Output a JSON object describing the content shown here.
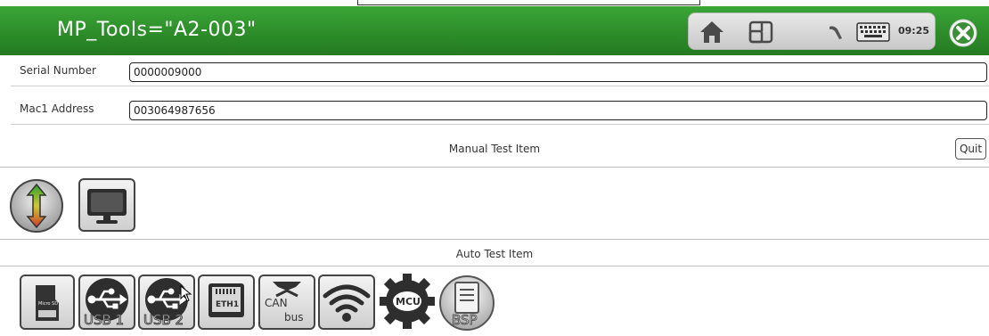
{
  "window": {
    "title": "MP_Tools=\"A2-003\"",
    "clock": "09:25",
    "accent_color": "#2e8f2b",
    "tray_icons": [
      "home-icon",
      "window-switch-icon",
      "pen-icon",
      "keyboard-icon"
    ],
    "close_icon": "close-icon"
  },
  "form": {
    "serial": {
      "label": "Serial Number",
      "value": "0000009000"
    },
    "mac": {
      "label": "Mac1 Address",
      "value": "003064987656"
    }
  },
  "manual": {
    "title": "Manual Test Item",
    "quit_label": "Quit",
    "items": [
      "up-down-arrow-icon",
      "monitor-icon"
    ]
  },
  "auto": {
    "title": "Auto Test Item",
    "items": [
      {
        "icon": "micro-sd-icon",
        "text": "Micro SD"
      },
      {
        "icon": "usb-icon",
        "caption": "USB 1"
      },
      {
        "icon": "usb-icon",
        "caption": "USB 2"
      },
      {
        "icon": "ethernet-icon",
        "text": "ETH1"
      },
      {
        "icon": "can-bus-icon",
        "text_top": "CAN",
        "text_bottom": "bus"
      },
      {
        "icon": "wifi-icon"
      },
      {
        "icon": "mcu-gear-icon",
        "text": "MCU"
      },
      {
        "icon": "bsp-icon",
        "text": "BSP"
      }
    ]
  }
}
